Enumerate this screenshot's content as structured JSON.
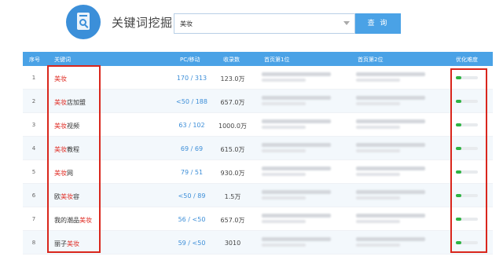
{
  "header": {
    "title": "关键词挖掘",
    "search_value": "美妆",
    "search_button": "查 询"
  },
  "colors": {
    "accent": "#4aa2e6",
    "highlight": "#e0322a",
    "difficulty": "#2fb344",
    "annotation": "#d9261c"
  },
  "table": {
    "columns": [
      "序号",
      "关键词",
      "PC/移动",
      "收录数",
      "首页第1位",
      "首页第2位",
      "优化难度"
    ],
    "rows": [
      {
        "index": "1",
        "kw_pre": "",
        "kw_hl": "美妆",
        "kw_post": "",
        "pc_mobile": "170 / 313",
        "count": "123.0万",
        "difficulty": 0.25
      },
      {
        "index": "2",
        "kw_pre": "",
        "kw_hl": "美妆",
        "kw_post": "店加盟",
        "pc_mobile": "<50 / 188",
        "count": "657.0万",
        "difficulty": 0.25
      },
      {
        "index": "3",
        "kw_pre": "",
        "kw_hl": "美妆",
        "kw_post": "视频",
        "pc_mobile": "63 / 102",
        "count": "1000.0万",
        "difficulty": 0.25
      },
      {
        "index": "4",
        "kw_pre": "",
        "kw_hl": "美妆",
        "kw_post": "教程",
        "pc_mobile": "69 / 69",
        "count": "615.0万",
        "difficulty": 0.25
      },
      {
        "index": "5",
        "kw_pre": "",
        "kw_hl": "美妆",
        "kw_post": "网",
        "pc_mobile": "79 / 51",
        "count": "930.0万",
        "difficulty": 0.25
      },
      {
        "index": "6",
        "kw_pre": "欧",
        "kw_hl": "美妆",
        "kw_post": "容",
        "pc_mobile": "<50 / 89",
        "count": "1.5万",
        "difficulty": 0.25
      },
      {
        "index": "7",
        "kw_pre": "我的潮品",
        "kw_hl": "美妆",
        "kw_post": "",
        "pc_mobile": "56 / <50",
        "count": "657.0万",
        "difficulty": 0.25
      },
      {
        "index": "8",
        "kw_pre": "丽子",
        "kw_hl": "美妆",
        "kw_post": "",
        "pc_mobile": "59 / <50",
        "count": "3010",
        "difficulty": 0.25
      }
    ]
  }
}
